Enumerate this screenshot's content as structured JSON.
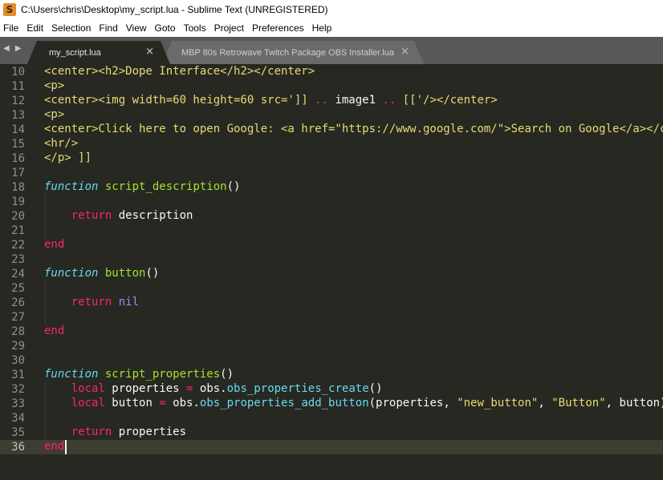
{
  "window": {
    "title": "C:\\Users\\chris\\Desktop\\my_script.lua - Sublime Text (UNREGISTERED)",
    "icon": "sublime-text-icon"
  },
  "menu": [
    "File",
    "Edit",
    "Selection",
    "Find",
    "View",
    "Goto",
    "Tools",
    "Project",
    "Preferences",
    "Help"
  ],
  "tabs": [
    {
      "label": "my_script.lua",
      "active": true,
      "close": "×"
    },
    {
      "label": "MBP 80s Retrowave Twitch Package OBS Installer.lua",
      "active": false,
      "close": "×"
    }
  ],
  "nav_arrows": "◀ ▶",
  "editor": {
    "current_line": 36,
    "lines": [
      {
        "n": 10,
        "tokens": [
          {
            "t": "str",
            "v": "<center><h2>Dope Interface</h2></center>"
          }
        ]
      },
      {
        "n": 11,
        "tokens": [
          {
            "t": "str",
            "v": "<p>"
          }
        ]
      },
      {
        "n": 12,
        "tokens": [
          {
            "t": "str",
            "v": "<center><img width=60 height=60 src='"
          },
          {
            "t": "str",
            "v": "]]"
          },
          {
            "t": "kw",
            "v": " .. "
          },
          {
            "t": "plain",
            "v": "image1"
          },
          {
            "t": "kw",
            "v": " .. "
          },
          {
            "t": "str",
            "v": "[['/></center>"
          }
        ]
      },
      {
        "n": 13,
        "tokens": [
          {
            "t": "str",
            "v": "<p>"
          }
        ]
      },
      {
        "n": 14,
        "tokens": [
          {
            "t": "str",
            "v": "<center>Click here to open Google: <a href=\"https://www.google.com/\">Search on Google</a></cen"
          }
        ]
      },
      {
        "n": 15,
        "tokens": [
          {
            "t": "str",
            "v": "<hr/>"
          }
        ]
      },
      {
        "n": 16,
        "tokens": [
          {
            "t": "str",
            "v": "</p> ]]"
          }
        ]
      },
      {
        "n": 17,
        "tokens": []
      },
      {
        "n": 18,
        "tokens": [
          {
            "t": "fn",
            "v": "function"
          },
          {
            "t": "plain",
            "v": " "
          },
          {
            "t": "def",
            "v": "script_description"
          },
          {
            "t": "plain",
            "v": "()"
          }
        ]
      },
      {
        "n": 19,
        "tokens": []
      },
      {
        "n": 20,
        "tokens": [
          {
            "t": "plain",
            "v": "    "
          },
          {
            "t": "kw",
            "v": "return"
          },
          {
            "t": "plain",
            "v": " description"
          }
        ]
      },
      {
        "n": 21,
        "tokens": []
      },
      {
        "n": 22,
        "tokens": [
          {
            "t": "kw",
            "v": "end"
          }
        ]
      },
      {
        "n": 23,
        "tokens": []
      },
      {
        "n": 24,
        "tokens": [
          {
            "t": "fn",
            "v": "function"
          },
          {
            "t": "plain",
            "v": " "
          },
          {
            "t": "def",
            "v": "button"
          },
          {
            "t": "plain",
            "v": "()"
          }
        ]
      },
      {
        "n": 25,
        "tokens": []
      },
      {
        "n": 26,
        "tokens": [
          {
            "t": "plain",
            "v": "    "
          },
          {
            "t": "kw",
            "v": "return"
          },
          {
            "t": "plain",
            "v": " "
          },
          {
            "t": "const",
            "v": "nil"
          }
        ]
      },
      {
        "n": 27,
        "tokens": []
      },
      {
        "n": 28,
        "tokens": [
          {
            "t": "kw",
            "v": "end"
          }
        ]
      },
      {
        "n": 29,
        "tokens": []
      },
      {
        "n": 30,
        "tokens": []
      },
      {
        "n": 31,
        "tokens": [
          {
            "t": "fn",
            "v": "function"
          },
          {
            "t": "plain",
            "v": " "
          },
          {
            "t": "def",
            "v": "script_properties"
          },
          {
            "t": "plain",
            "v": "()"
          }
        ]
      },
      {
        "n": 32,
        "tokens": [
          {
            "t": "plain",
            "v": "    "
          },
          {
            "t": "kw",
            "v": "local"
          },
          {
            "t": "plain",
            "v": " properties "
          },
          {
            "t": "kw",
            "v": "="
          },
          {
            "t": "plain",
            "v": " obs."
          },
          {
            "t": "call",
            "v": "obs_properties_create"
          },
          {
            "t": "plain",
            "v": "()"
          }
        ]
      },
      {
        "n": 33,
        "tokens": [
          {
            "t": "plain",
            "v": "    "
          },
          {
            "t": "kw",
            "v": "local"
          },
          {
            "t": "plain",
            "v": " button "
          },
          {
            "t": "kw",
            "v": "="
          },
          {
            "t": "plain",
            "v": " obs."
          },
          {
            "t": "call",
            "v": "obs_properties_add_button"
          },
          {
            "t": "plain",
            "v": "(properties, "
          },
          {
            "t": "str",
            "v": "\"new_button\""
          },
          {
            "t": "plain",
            "v": ", "
          },
          {
            "t": "str",
            "v": "\"Button\""
          },
          {
            "t": "plain",
            "v": ", button)"
          }
        ]
      },
      {
        "n": 34,
        "tokens": []
      },
      {
        "n": 35,
        "tokens": [
          {
            "t": "plain",
            "v": "    "
          },
          {
            "t": "kw",
            "v": "return"
          },
          {
            "t": "plain",
            "v": " properties"
          }
        ]
      },
      {
        "n": 36,
        "tokens": [
          {
            "t": "kw",
            "v": "end"
          }
        ]
      }
    ]
  },
  "colors": {
    "background": "#272822",
    "string": "#e6db74",
    "keyword": "#f92672",
    "storage": "#66d9ef",
    "function_name": "#a6e22e",
    "constant": "#ae81ff"
  }
}
